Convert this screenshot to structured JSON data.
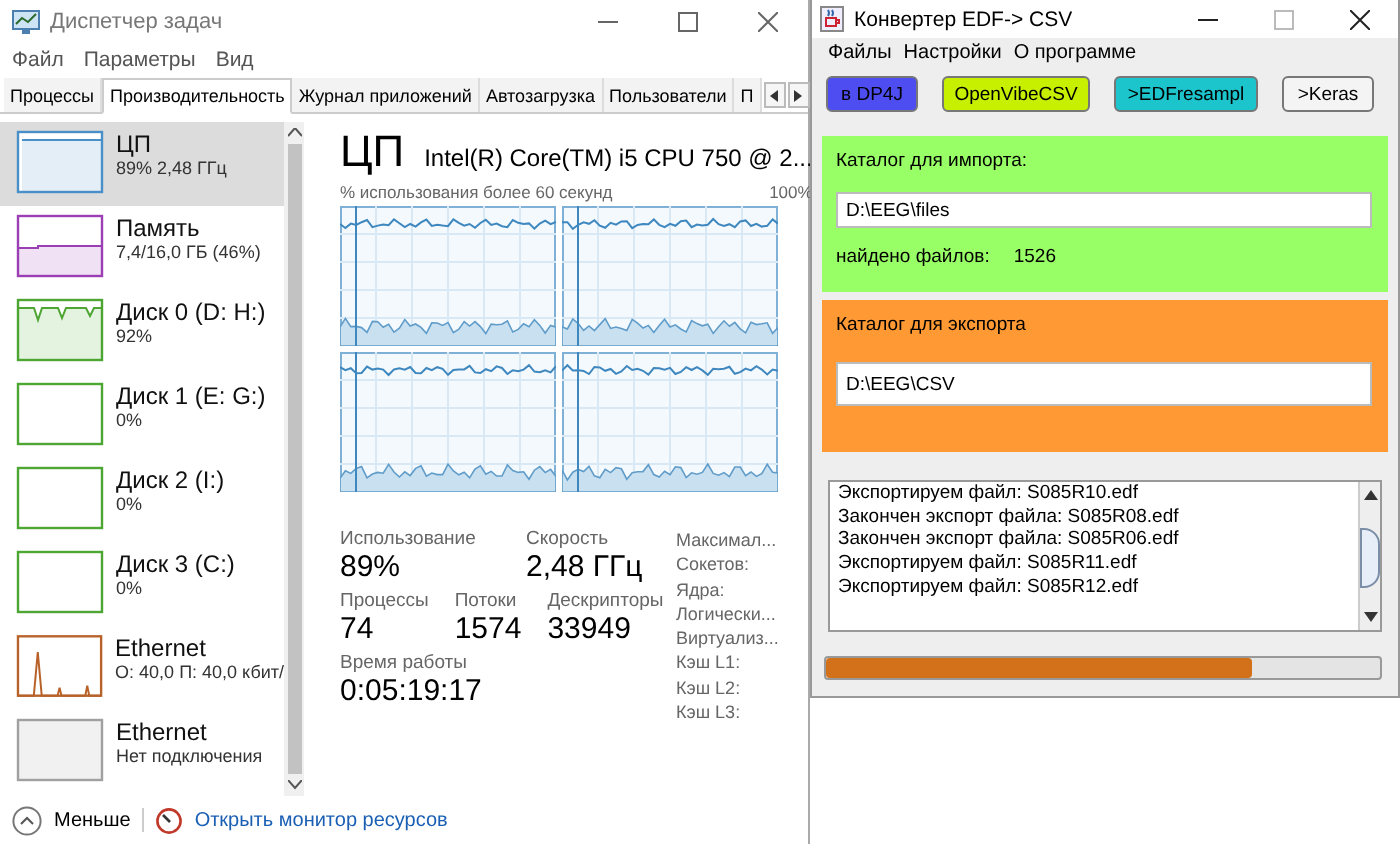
{
  "task_manager": {
    "title": "Диспетчер задач",
    "menu": [
      "Файл",
      "Параметры",
      "Вид"
    ],
    "tabs": [
      {
        "label": "Процессы",
        "selected": false
      },
      {
        "label": "Производительность",
        "selected": true
      },
      {
        "label": "Журнал приложений",
        "selected": false
      },
      {
        "label": "Автозагрузка",
        "selected": false
      },
      {
        "label": "Пользователи",
        "selected": false
      },
      {
        "label": "П",
        "selected": false
      }
    ],
    "sidebar": [
      {
        "kind": "cpu",
        "name": "ЦП",
        "detail": "89% 2,48 ГГц",
        "color": "#4a90c8",
        "selected": true
      },
      {
        "kind": "memory",
        "name": "Память",
        "detail": "7,4/16,0 ГБ (46%)",
        "color": "#9b3fb5",
        "selected": false
      },
      {
        "kind": "disk-busy",
        "name": "Диск 0 (D: H:)",
        "detail": "92%",
        "color": "#4da532",
        "selected": false
      },
      {
        "kind": "disk",
        "name": "Диск 1 (E: G:)",
        "detail": "0%",
        "color": "#4da532",
        "selected": false
      },
      {
        "kind": "disk",
        "name": "Диск 2 (I:)",
        "detail": "0%",
        "color": "#4da532",
        "selected": false
      },
      {
        "kind": "disk",
        "name": "Диск 3 (C:)",
        "detail": "0%",
        "color": "#4da532",
        "selected": false
      },
      {
        "kind": "network",
        "name": "Ethernet",
        "detail": "О: 40,0 П: 40,0 кбит/",
        "color": "#b8622a",
        "selected": false
      },
      {
        "kind": "network-off",
        "name": "Ethernet",
        "detail": "Нет подключения",
        "color": "#a0a0a0",
        "selected": false
      }
    ],
    "heading": "ЦП",
    "model": "Intel(R) Core(TM) i5 CPU 750 @ 2...",
    "graph_caption": "% использования более 60 секунд",
    "graph_max": "100%",
    "stats": [
      {
        "label": "Использование",
        "value": "89%"
      },
      {
        "label": "Скорость",
        "value": "2,48 ГГц"
      }
    ],
    "counts": [
      {
        "label": "Процессы",
        "value": "74"
      },
      {
        "label": "Потоки",
        "value": "1574"
      },
      {
        "label": "Дескрипторы",
        "value": "33949"
      }
    ],
    "uptime": {
      "label": "Время работы",
      "value": "0:05:19:17"
    },
    "specs": [
      "Максимал...",
      "Сокетов:",
      "Ядра:",
      "Логически...",
      "Виртуализ...",
      "Кэш L1:",
      "Кэш L2:",
      "Кэш L3:"
    ],
    "fewer": "Меньше",
    "resource_monitor": "Открыть монитор ресурсов"
  },
  "converter": {
    "title": "Конвертер EDF-> CSV",
    "menu": [
      "Файлы",
      "Настройки",
      "О программе"
    ],
    "buttons": [
      {
        "label": "в DP4J",
        "color": "#4d4df2"
      },
      {
        "label": "OpenVibeCSV",
        "color": "#c6f000"
      },
      {
        "label": ">EDFresampl",
        "color": "#1cc4cc"
      },
      {
        "label": ">Keras",
        "color": "#f4f4f4"
      }
    ],
    "import": {
      "label": "Каталог для импорта:",
      "value": "D:\\EEG\\files",
      "found_label": "найдено файлов:",
      "found": "1526"
    },
    "export": {
      "label": "Каталог для экспорта",
      "value": "D:\\EEG\\CSV"
    },
    "log": [
      "Экспортируем файл: S085R10.edf",
      "Закончен экспорт файла: S085R08.edf",
      "Закончен экспорт файла: S085R06.edf",
      "Экспортируем файл: S085R11.edf",
      "Экспортируем файл: S085R12.edf"
    ],
    "progress": {
      "level": 0.77
    }
  }
}
